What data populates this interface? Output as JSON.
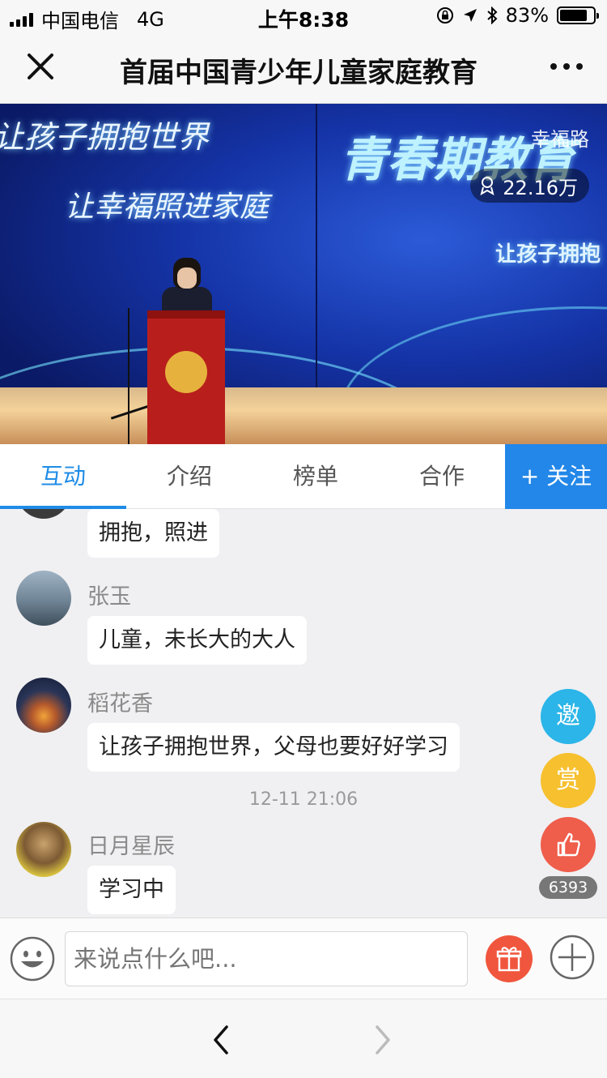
{
  "status_bar": {
    "carrier": "中国电信",
    "network": "4G",
    "time": "上午8:38",
    "battery_percent": "83%",
    "battery_level": 0.83
  },
  "nav": {
    "title": "首届中国青少年儿童家庭教育"
  },
  "video": {
    "watermark": "幸福路",
    "viewers": "22.16万",
    "banner_left_1": "让孩子拥抱世界",
    "banner_left_2": "让幸福照进家庭",
    "banner_right_1": "青春期教育",
    "banner_right_2": "让孩子拥抱"
  },
  "tabs": {
    "items": [
      "互动",
      "介绍",
      "榜单",
      "合作"
    ],
    "active_index": 0,
    "follow_label": "+ 关注"
  },
  "chat": {
    "partial_bubble": "拥抱，照进",
    "messages": [
      {
        "user": "张玉",
        "text": "儿童，未长大的大人"
      },
      {
        "user": "稻花香",
        "text": "让孩子拥抱世界，父母也要好好学习"
      },
      {
        "user": "日月星辰",
        "text": "学习中"
      }
    ],
    "timestamp": "12-11 21:06"
  },
  "side_actions": {
    "invite_label": "邀",
    "reward_label": "赏",
    "like_count": "6393",
    "colors": {
      "invite": "#2bb5e8",
      "reward": "#f6c02e",
      "like": "#ef5d4b"
    }
  },
  "input": {
    "placeholder": "来说点什么吧..."
  },
  "accent_color": "#2287e8"
}
